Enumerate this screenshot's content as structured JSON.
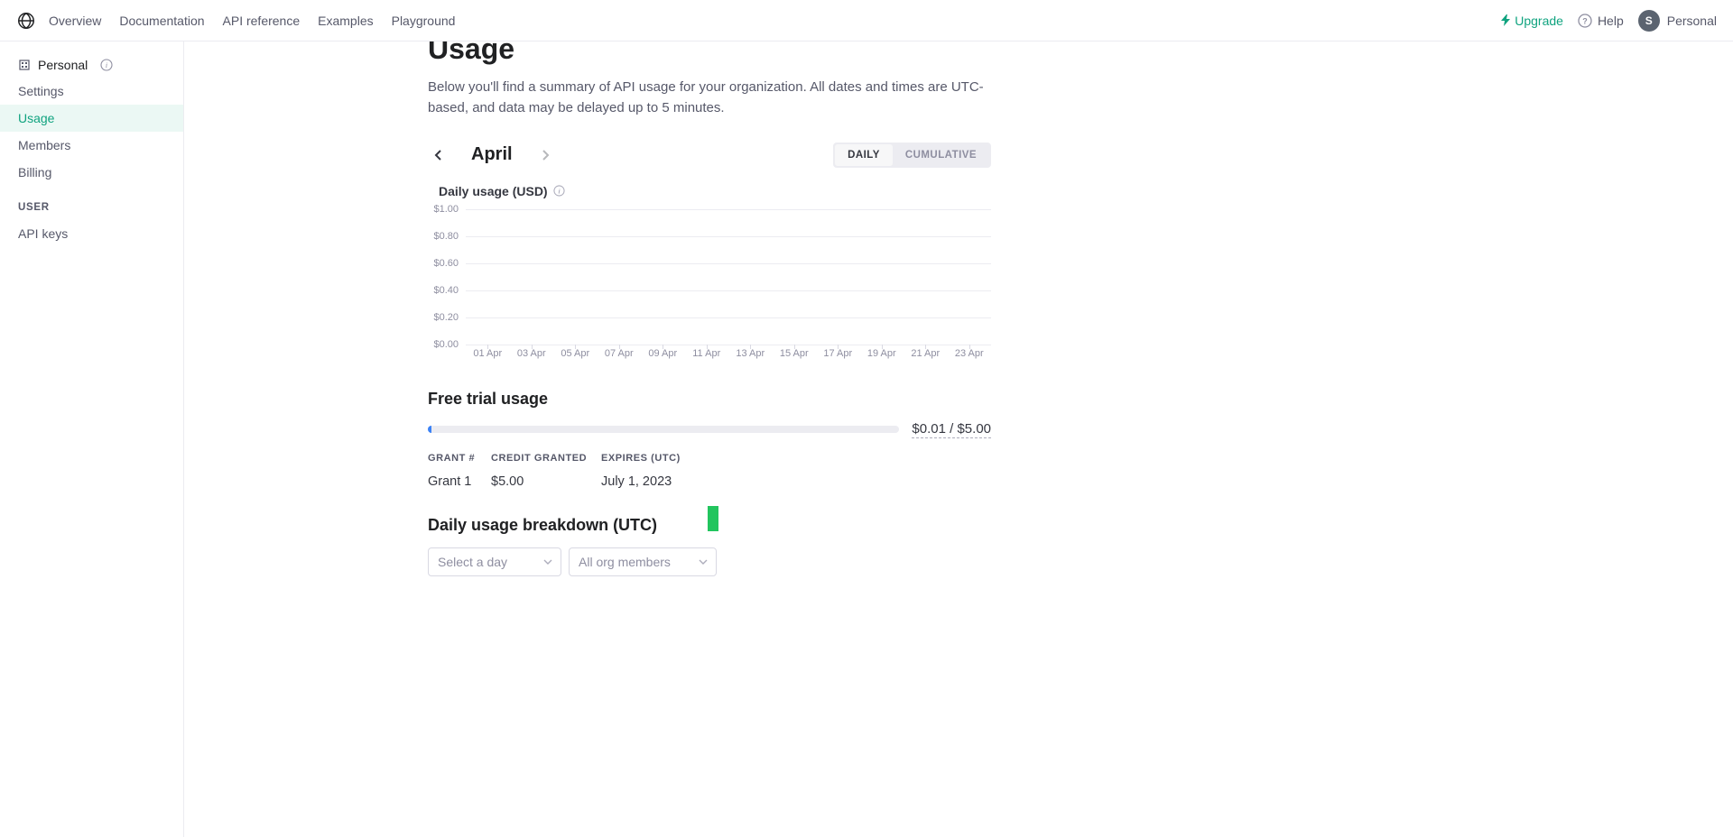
{
  "topbar": {
    "nav": {
      "overview": "Overview",
      "documentation": "Documentation",
      "api_reference": "API reference",
      "examples": "Examples",
      "playground": "Playground"
    },
    "upgrade": "Upgrade",
    "help": "Help",
    "personal": "Personal",
    "avatar_letter": "S"
  },
  "sidebar": {
    "org_label": "Personal",
    "items": {
      "settings": "Settings",
      "usage": "Usage",
      "members": "Members",
      "billing": "Billing"
    },
    "user_header": "USER",
    "api_keys": "API keys"
  },
  "page": {
    "title": "Usage",
    "intro": "Below you'll find a summary of API usage for your organization. All dates and times are UTC-based, and data may be delayed up to 5 minutes.",
    "month": "April",
    "toggles": {
      "daily": "DAILY",
      "cumulative": "CUMULATIVE"
    },
    "chart_title": "Daily usage (USD)"
  },
  "free_trial": {
    "title": "Free trial usage",
    "amount": "$0.01 / $5.00",
    "progress_pct": 0.7,
    "headers": {
      "grant": "GRANT #",
      "credit": "CREDIT GRANTED",
      "expires": "EXPIRES (UTC)"
    },
    "row": {
      "grant": "Grant 1",
      "credit": "$5.00",
      "expires": "July 1, 2023"
    }
  },
  "breakdown": {
    "title": "Daily usage breakdown (UTC)",
    "select_day": "Select a day",
    "select_members": "All org members"
  },
  "chart_data": {
    "type": "bar",
    "title": "Daily usage (USD)",
    "xlabel": "",
    "ylabel": "USD",
    "ylim": [
      0,
      1.0
    ],
    "y_ticks": [
      "$1.00",
      "$0.80",
      "$0.60",
      "$0.40",
      "$0.20",
      "$0.00"
    ],
    "categories": [
      "01 Apr",
      "03 Apr",
      "05 Apr",
      "07 Apr",
      "09 Apr",
      "11 Apr",
      "13 Apr",
      "15 Apr",
      "17 Apr",
      "19 Apr",
      "21 Apr",
      "23 Apr"
    ],
    "values": [
      0,
      0,
      0,
      0,
      0,
      0,
      0,
      0,
      0,
      0,
      0,
      0
    ]
  }
}
